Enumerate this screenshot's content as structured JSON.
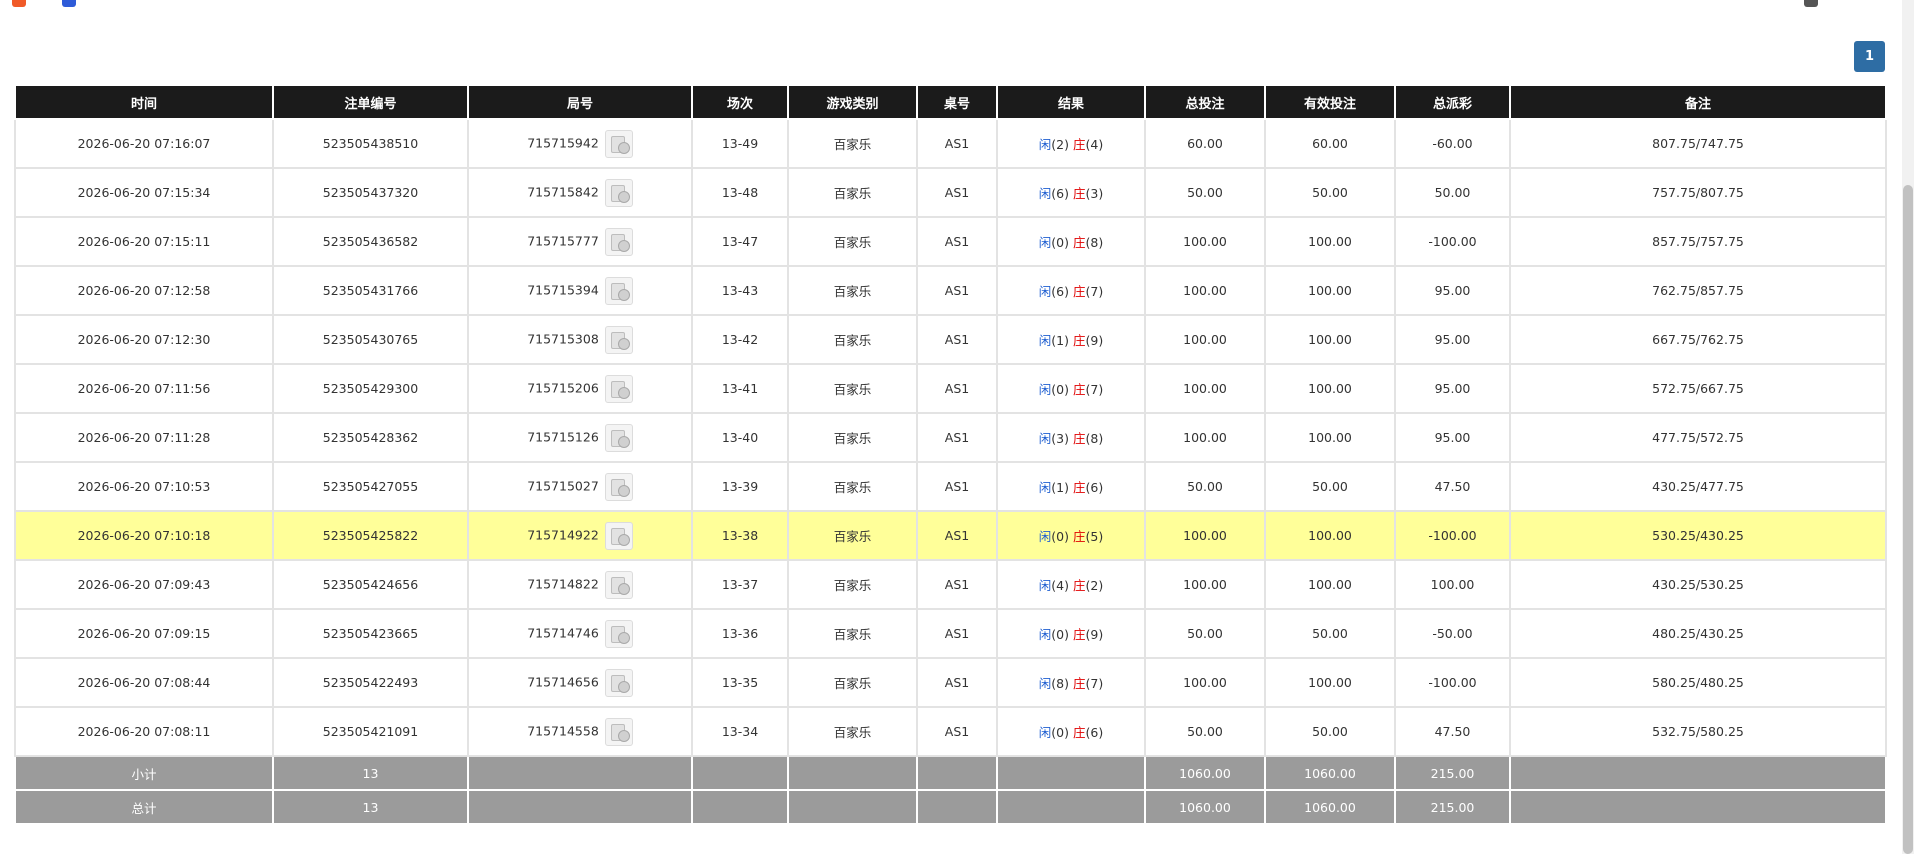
{
  "pager": {
    "current": "1"
  },
  "columns": [
    "时间",
    "注单编号",
    "局号",
    "场次",
    "游戏类别",
    "桌号",
    "结果",
    "总投注",
    "有效投注",
    "总派彩",
    "备注"
  ],
  "result_labels": {
    "player": "闲",
    "banker": "庄"
  },
  "rows": [
    {
      "time": "2026-06-20 07:16:07",
      "order": "523505438510",
      "round": "715715942",
      "session": "13-49",
      "game": "百家乐",
      "table": "AS1",
      "player": "(2)",
      "banker": "(4)",
      "bet": "60.00",
      "valid": "60.00",
      "payout": "-60.00",
      "payout_neg": true,
      "note": "807.75/747.75"
    },
    {
      "time": "2026-06-20 07:15:34",
      "order": "523505437320",
      "round": "715715842",
      "session": "13-48",
      "game": "百家乐",
      "table": "AS1",
      "player": "(6)",
      "banker": "(3)",
      "bet": "50.00",
      "valid": "50.00",
      "payout": "50.00",
      "payout_neg": false,
      "note": "757.75/807.75"
    },
    {
      "time": "2026-06-20 07:15:11",
      "order": "523505436582",
      "round": "715715777",
      "session": "13-47",
      "game": "百家乐",
      "table": "AS1",
      "player": "(0)",
      "banker": "(8)",
      "bet": "100.00",
      "valid": "100.00",
      "payout": "-100.00",
      "payout_neg": true,
      "note": "857.75/757.75"
    },
    {
      "time": "2026-06-20 07:12:58",
      "order": "523505431766",
      "round": "715715394",
      "session": "13-43",
      "game": "百家乐",
      "table": "AS1",
      "player": "(6)",
      "banker": "(7)",
      "bet": "100.00",
      "valid": "100.00",
      "payout": "95.00",
      "payout_neg": false,
      "note": "762.75/857.75"
    },
    {
      "time": "2026-06-20 07:12:30",
      "order": "523505430765",
      "round": "715715308",
      "session": "13-42",
      "game": "百家乐",
      "table": "AS1",
      "player": "(1)",
      "banker": "(9)",
      "bet": "100.00",
      "valid": "100.00",
      "payout": "95.00",
      "payout_neg": false,
      "note": "667.75/762.75"
    },
    {
      "time": "2026-06-20 07:11:56",
      "order": "523505429300",
      "round": "715715206",
      "session": "13-41",
      "game": "百家乐",
      "table": "AS1",
      "player": "(0)",
      "banker": "(7)",
      "bet": "100.00",
      "valid": "100.00",
      "payout": "95.00",
      "payout_neg": false,
      "note": "572.75/667.75"
    },
    {
      "time": "2026-06-20 07:11:28",
      "order": "523505428362",
      "round": "715715126",
      "session": "13-40",
      "game": "百家乐",
      "table": "AS1",
      "player": "(3)",
      "banker": "(8)",
      "bet": "100.00",
      "valid": "100.00",
      "payout": "95.00",
      "payout_neg": false,
      "note": "477.75/572.75"
    },
    {
      "time": "2026-06-20 07:10:53",
      "order": "523505427055",
      "round": "715715027",
      "session": "13-39",
      "game": "百家乐",
      "table": "AS1",
      "player": "(1)",
      "banker": "(6)",
      "bet": "50.00",
      "valid": "50.00",
      "payout": "47.50",
      "payout_neg": false,
      "note": "430.25/477.75"
    },
    {
      "time": "2026-06-20 07:10:18",
      "order": "523505425822",
      "round": "715714922",
      "session": "13-38",
      "game": "百家乐",
      "table": "AS1",
      "player": "(0)",
      "banker": "(5)",
      "bet": "100.00",
      "valid": "100.00",
      "payout": "-100.00",
      "payout_neg": true,
      "note": "530.25/430.25",
      "highlight": true
    },
    {
      "time": "2026-06-20 07:09:43",
      "order": "523505424656",
      "round": "715714822",
      "session": "13-37",
      "game": "百家乐",
      "table": "AS1",
      "player": "(4)",
      "banker": "(2)",
      "bet": "100.00",
      "valid": "100.00",
      "payout": "100.00",
      "payout_neg": false,
      "note": "430.25/530.25"
    },
    {
      "time": "2026-06-20 07:09:15",
      "order": "523505423665",
      "round": "715714746",
      "session": "13-36",
      "game": "百家乐",
      "table": "AS1",
      "player": "(0)",
      "banker": "(9)",
      "bet": "50.00",
      "valid": "50.00",
      "payout": "-50.00",
      "payout_neg": true,
      "note": "480.25/430.25"
    },
    {
      "time": "2026-06-20 07:08:44",
      "order": "523505422493",
      "round": "715714656",
      "session": "13-35",
      "game": "百家乐",
      "table": "AS1",
      "player": "(8)",
      "banker": "(7)",
      "bet": "100.00",
      "valid": "100.00",
      "payout": "-100.00",
      "payout_neg": true,
      "note": "580.25/480.25"
    },
    {
      "time": "2026-06-20 07:08:11",
      "order": "523505421091",
      "round": "715714558",
      "session": "13-34",
      "game": "百家乐",
      "table": "AS1",
      "player": "(0)",
      "banker": "(6)",
      "bet": "50.00",
      "valid": "50.00",
      "payout": "47.50",
      "payout_neg": false,
      "note": "532.75/580.25"
    }
  ],
  "subtotal": {
    "label": "小计",
    "count": "13",
    "bet": "1060.00",
    "valid": "1060.00",
    "payout": "215.00"
  },
  "total": {
    "label": "总计",
    "count": "13",
    "bet": "1060.00",
    "valid": "1060.00",
    "payout": "215.00"
  },
  "colors": {
    "header_bg": "#1b1b1b",
    "footer_bg": "#9b9b9b",
    "highlight": "#ffff99",
    "blue": "#1f5fd1",
    "red": "#e00000",
    "pager": "#2e6da4"
  }
}
